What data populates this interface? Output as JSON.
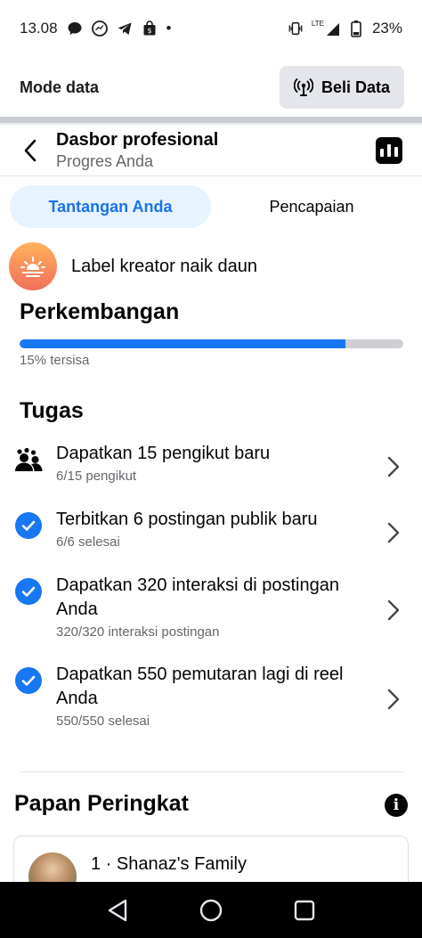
{
  "status_bar": {
    "time": "13.08",
    "network_label": "LTE",
    "battery": "23%",
    "dot": "•"
  },
  "mode_bar": {
    "title": "Mode data",
    "buy_label": "Beli Data"
  },
  "header": {
    "title": "Dasbor profesional",
    "subtitle": "Progres Anda"
  },
  "tabs": [
    {
      "label": "Tantangan Anda",
      "active": true
    },
    {
      "label": "Pencapaian",
      "active": false
    }
  ],
  "creator_label": "Label kreator naik daun",
  "progress": {
    "title": "Perkembangan",
    "value": 0.85,
    "remaining_text": "15% tersisa",
    "fill_color": "#1877f2"
  },
  "tasks_section": {
    "title": "Tugas",
    "items": [
      {
        "icon": "people-icon",
        "title": "Dapatkan 15 pengikut baru",
        "sub": "6/15 pengikut"
      },
      {
        "icon": "check-circle-icon",
        "title": "Terbitkan 6 postingan publik baru",
        "sub": "6/6 selesai"
      },
      {
        "icon": "check-circle-icon",
        "title": "Dapatkan 320 interaksi di postingan Anda",
        "sub": "320/320 interaksi postingan"
      },
      {
        "icon": "check-circle-icon",
        "title": "Dapatkan 550 pemutaran lagi di reel Anda",
        "sub": "550/550 selesai"
      }
    ]
  },
  "leaderboard": {
    "title": "Papan Peringkat",
    "first_entry": "1 · Shanaz's Family"
  },
  "colors": {
    "accent": "#1877f2",
    "tab_active_bg": "#e7f3ff"
  }
}
